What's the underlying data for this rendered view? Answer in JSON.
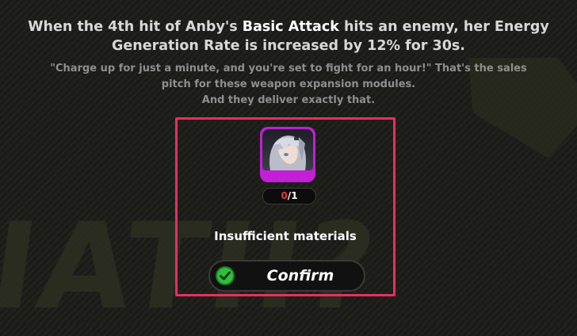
{
  "effect": {
    "line1_prefix": "When the 4th hit of Anby's ",
    "line1_highlight": "Basic Attack",
    "line1_suffix": " hits an enemy, her Energy",
    "line2": "Generation Rate is increased by 12% for 30s."
  },
  "flavor": {
    "line1": "\"Charge up for just a minute, and you're set to fight for an hour!\" That's the sales",
    "line2": "pitch for these weapon expansion modules.",
    "line3": "And they deliver exactly that."
  },
  "material": {
    "have": "0",
    "separator": "/",
    "need": "1",
    "icon": "anby-portrait-icon",
    "rarity_color": "#c21fd6"
  },
  "status": "Insufficient materials",
  "confirm": {
    "label": "Confirm",
    "icon": "check-icon"
  },
  "colors": {
    "highlight_border": "#e8305f",
    "insufficient_count": "#e23a3a",
    "confirm_check": "#2fbf3d"
  }
}
